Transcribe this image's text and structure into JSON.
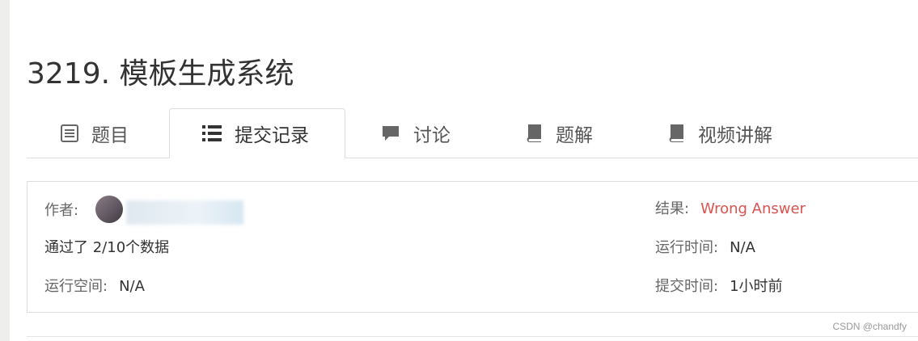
{
  "problem": {
    "title": "3219. 模板生成系统"
  },
  "tabs": [
    {
      "label": "题目",
      "icon": "file-text-icon",
      "active": false
    },
    {
      "label": "提交记录",
      "icon": "list-icon",
      "active": true
    },
    {
      "label": "讨论",
      "icon": "comment-icon",
      "active": false
    },
    {
      "label": "题解",
      "icon": "book-icon",
      "active": false
    },
    {
      "label": "视频讲解",
      "icon": "book-icon",
      "active": false
    }
  ],
  "submission": {
    "author_label": "作者:",
    "result_label": "结果:",
    "result_value": "Wrong Answer",
    "passed_text": "通过了 2/10个数据",
    "runtime_label": "运行时间:",
    "runtime_value": "N/A",
    "memory_label": "运行空间:",
    "memory_value": "N/A",
    "submit_time_label": "提交时间:",
    "submit_time_value": "1小时前"
  },
  "colors": {
    "result_error": "#d9534f",
    "border": "#dddddd"
  },
  "watermark": "CSDN @chandfy"
}
